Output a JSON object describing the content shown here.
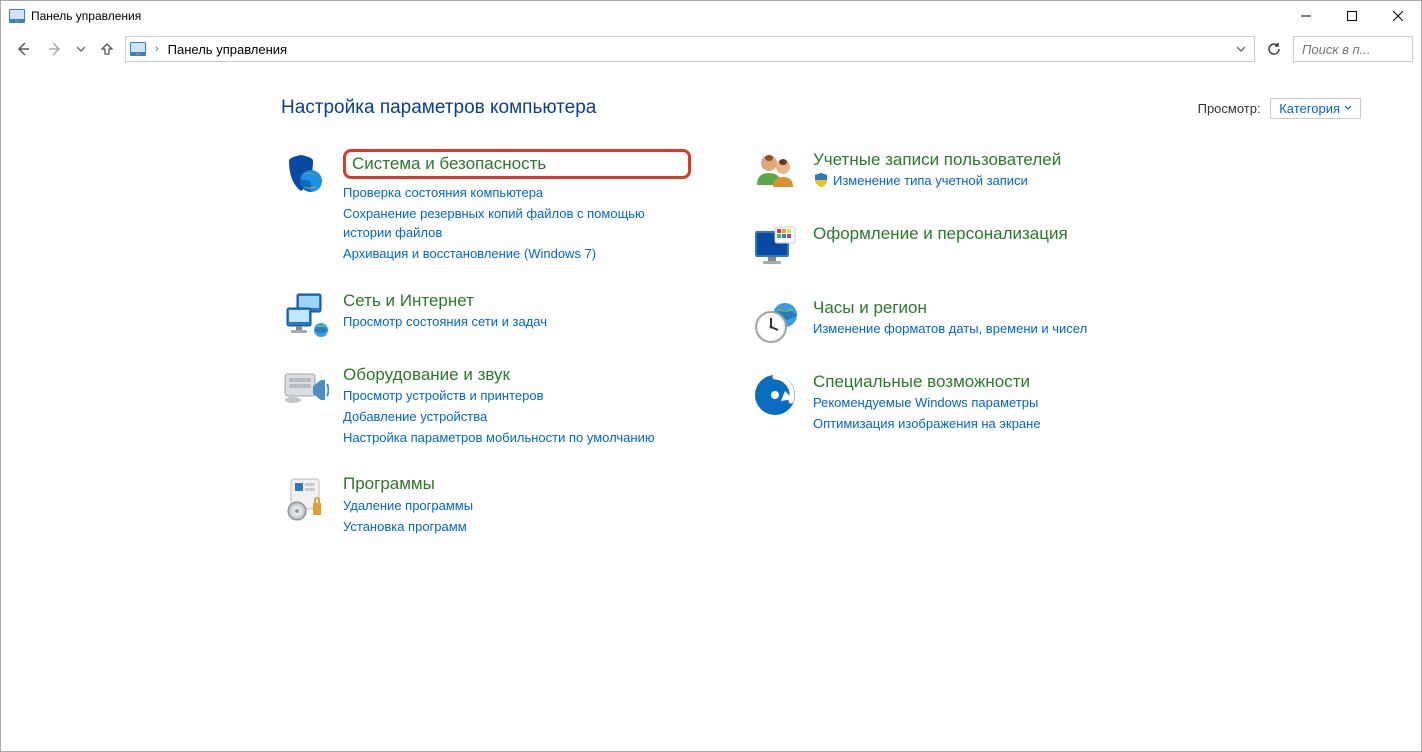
{
  "window": {
    "title": "Панель управления"
  },
  "nav": {
    "address_text": "Панель управления",
    "search_placeholder": "Поиск в п..."
  },
  "header": {
    "heading": "Настройка параметров компьютера",
    "view_label": "Просмотр:",
    "view_value": "Категория"
  },
  "left": {
    "system": {
      "title": "Система и безопасность",
      "links": [
        "Проверка состояния компьютера",
        "Сохранение резервных копий файлов с помощью истории файлов",
        "Архивация и восстановление (Windows 7)"
      ]
    },
    "network": {
      "title": "Сеть и Интернет",
      "links": [
        "Просмотр состояния сети и задач"
      ]
    },
    "hardware": {
      "title": "Оборудование и звук",
      "links": [
        "Просмотр устройств и принтеров",
        "Добавление устройства",
        "Настройка параметров мобильности по умолчанию"
      ]
    },
    "programs": {
      "title": "Программы",
      "links": [
        "Удаление программы",
        "Установка программ"
      ]
    }
  },
  "right": {
    "accounts": {
      "title": "Учетные записи пользователей",
      "links": [
        "Изменение типа учетной записи"
      ]
    },
    "appearance": {
      "title": "Оформление и персонализация"
    },
    "clock": {
      "title": "Часы и регион",
      "links": [
        "Изменение форматов даты, времени и чисел"
      ]
    },
    "ease": {
      "title": "Специальные возможности",
      "links": [
        "Рекомендуемые Windows параметры",
        "Оптимизация изображения на экране"
      ]
    }
  }
}
